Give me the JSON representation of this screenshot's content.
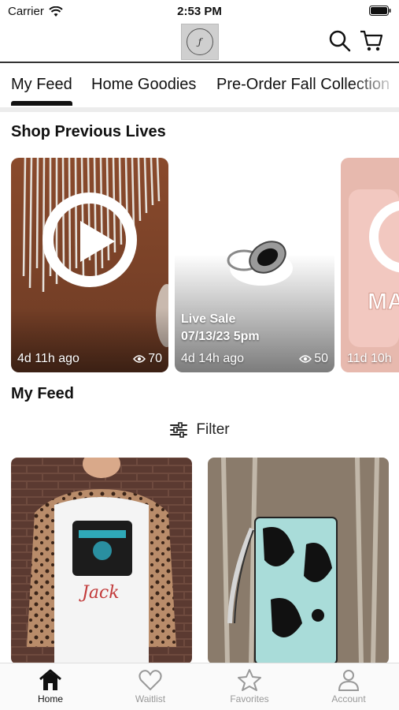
{
  "status": {
    "carrier": "Carrier",
    "time": "2:53 PM"
  },
  "header": {
    "logo_icon": "boutique-logo",
    "search_icon": "search-icon",
    "cart_icon": "cart-icon"
  },
  "tabs": [
    {
      "label": "My Feed",
      "active": true
    },
    {
      "label": "Home Goodies",
      "active": false
    },
    {
      "label": "Pre-Order Fall Collection",
      "active": false
    }
  ],
  "lives": {
    "title": "Shop Previous Lives",
    "cards": [
      {
        "ago": "4d 11h ago",
        "views": "70",
        "title_lines": []
      },
      {
        "ago": "4d 14h ago",
        "views": "50",
        "title_lines": [
          "Live Sale",
          "07/13/23 5pm"
        ]
      },
      {
        "ago": "11d 10h",
        "views": "",
        "title_lines": []
      }
    ]
  },
  "feed": {
    "title": "My Feed",
    "filter_label": "Filter"
  },
  "nav": [
    {
      "label": "Home",
      "icon": "home-icon",
      "active": true
    },
    {
      "label": "Waitlist",
      "icon": "heart-icon",
      "active": false
    },
    {
      "label": "Favorites",
      "icon": "star-icon",
      "active": false
    },
    {
      "label": "Account",
      "icon": "person-icon",
      "active": false
    }
  ],
  "colors": {
    "accent": "#111111",
    "inactive": "#999999"
  }
}
